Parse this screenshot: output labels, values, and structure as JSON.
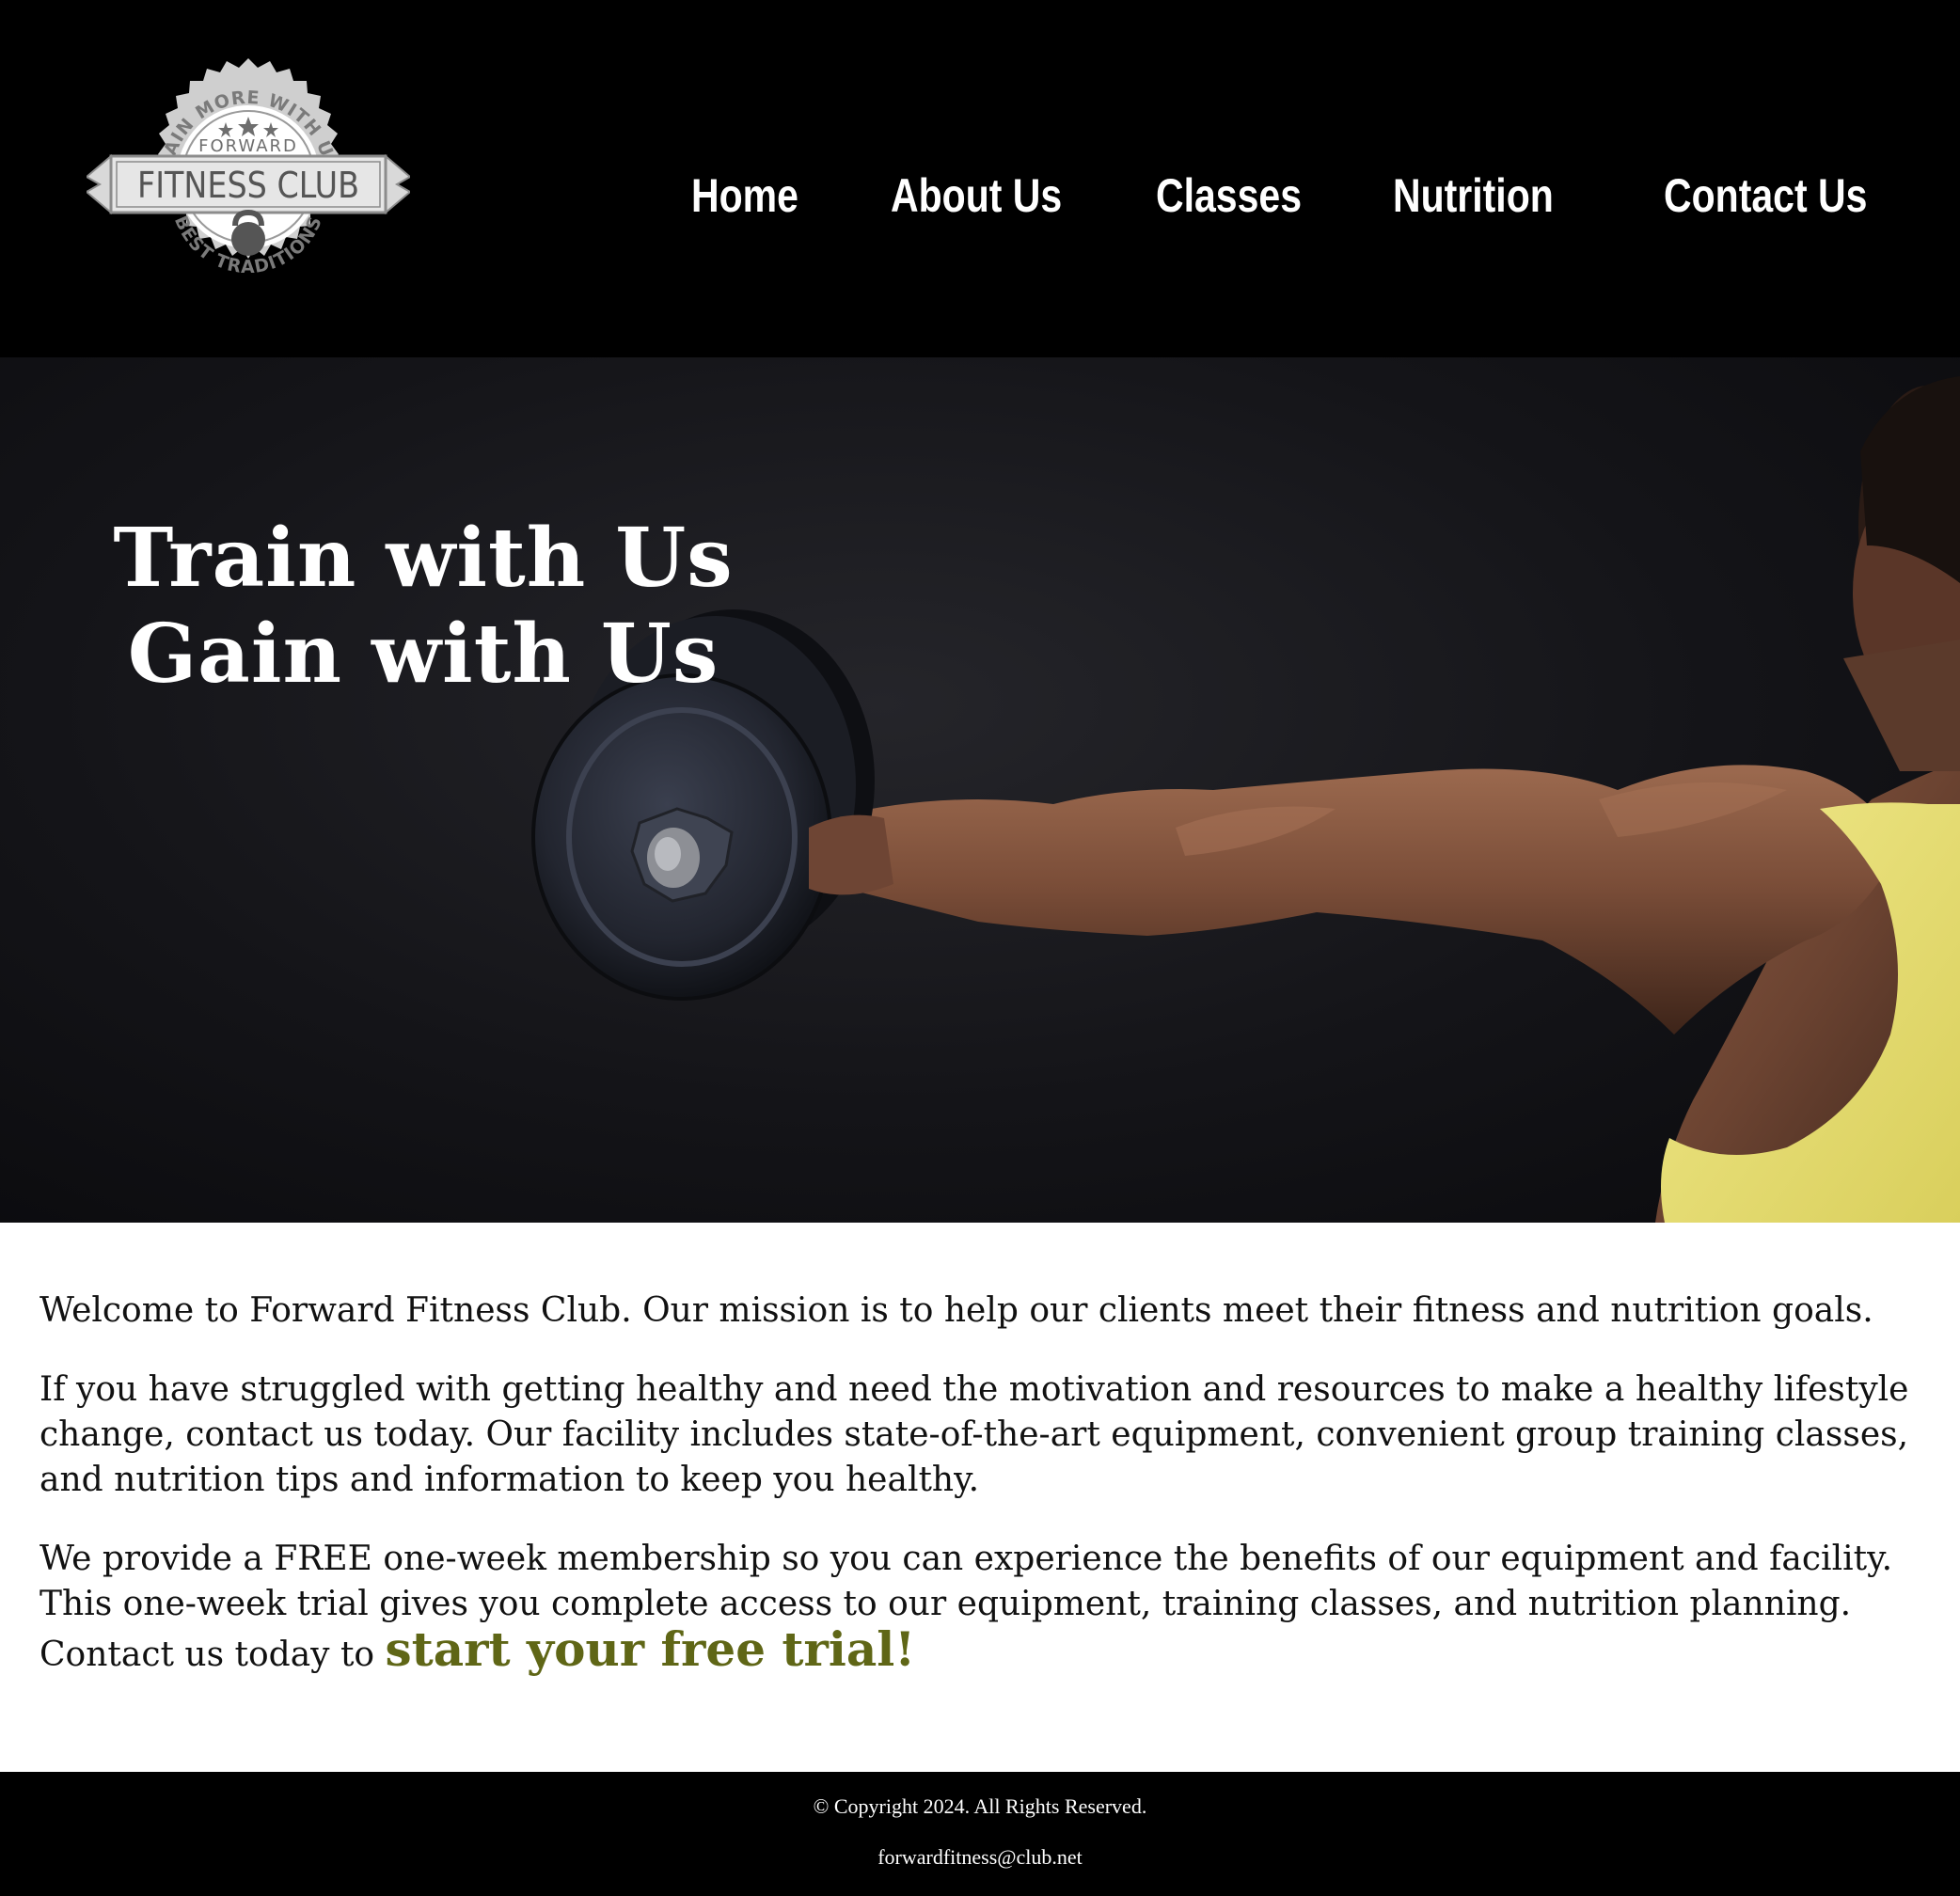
{
  "header": {
    "logo": {
      "top_arc": "GAIN MORE WITH US",
      "small_name": "FORWARD",
      "ribbon": "FITNESS CLUB",
      "bottom_arc": "BEST TRADITIONS"
    },
    "nav": [
      {
        "label": "Home"
      },
      {
        "label": "About Us"
      },
      {
        "label": "Classes"
      },
      {
        "label": "Nutrition"
      },
      {
        "label": "Contact Us"
      }
    ]
  },
  "hero": {
    "line1": "Train with Us",
    "line2": "Gain with Us"
  },
  "content": {
    "p1": "Welcome to Forward Fitness Club. Our mission is to help our clients meet their fitness and nutrition goals.",
    "p2": "If you have struggled with getting healthy and need the motivation and resources to make a healthy lifestyle change, contact us today. Our facility includes state-of-the-art equipment, convenient group training classes, and nutrition tips and information to keep you healthy.",
    "p3": "We provide a FREE one-week membership so you can experience the benefits of our equipment and facility. This one-week trial gives you complete access to our equipment, training classes, and nutrition planning. Contact us today to ",
    "cta": "start your free trial!"
  },
  "footer": {
    "copyright": "© Copyright 2024. All Rights Reserved.",
    "email": "forwardfitness@club.net"
  },
  "colors": {
    "header_bg": "#000000",
    "cta": "#5f6616",
    "tank_top": "#e8e07a"
  },
  "icons": [
    "logo-badge",
    "kettlebell-icon",
    "star-icon"
  ]
}
